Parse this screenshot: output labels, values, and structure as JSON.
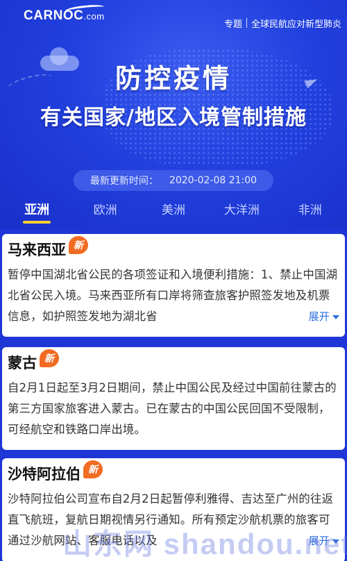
{
  "header": {
    "logo": "CARNOC",
    "logo_suffix": ".com",
    "special_label": "专题",
    "special_title": "全球民航应对新型肺炎"
  },
  "banner": {
    "title": "防控疫情",
    "subtitle": "有关国家/地区入境管制措施",
    "update_label": "最新更新时间：",
    "update_time": "2020-02-08 21:00"
  },
  "tabs": [
    {
      "label": "亚洲",
      "active": true
    },
    {
      "label": "欧洲",
      "active": false
    },
    {
      "label": "美洲",
      "active": false
    },
    {
      "label": "大洋洲",
      "active": false
    },
    {
      "label": "非洲",
      "active": false
    }
  ],
  "badge_text": "新",
  "expand_label": "展开",
  "cards": [
    {
      "title": "马来西亚",
      "body": "暂停中国湖北省公民的各项签证和入境便利措施：1、禁止中国湖北省公民入境。马来西亚所有口岸将筛查旅客护照签发地及机票信息，如护照签发地为湖北省"
    },
    {
      "title": "蒙古",
      "body": "自2月1日起至3月2日期间，禁止中国公民及经过中国前往蒙古的第三方国家旅客进入蒙古。已在蒙古的中国公民回国不受限制，可经航空和铁路口岸出境。"
    },
    {
      "title": "沙特阿拉伯",
      "body": "沙特阿拉伯公司宣布自2月2日起暂停利雅得、吉达至广州的往返直飞航班，复航日期视情另行通知。所有预定沙航机票的旅客可通过沙航网站、客服电话以及"
    }
  ],
  "watermark": "山东网 shandou.net",
  "colors": {
    "background": "#1f36d6",
    "accent_tab_underline": "#f7d030",
    "badge": "#f26b22",
    "link": "#2f6fe0"
  }
}
